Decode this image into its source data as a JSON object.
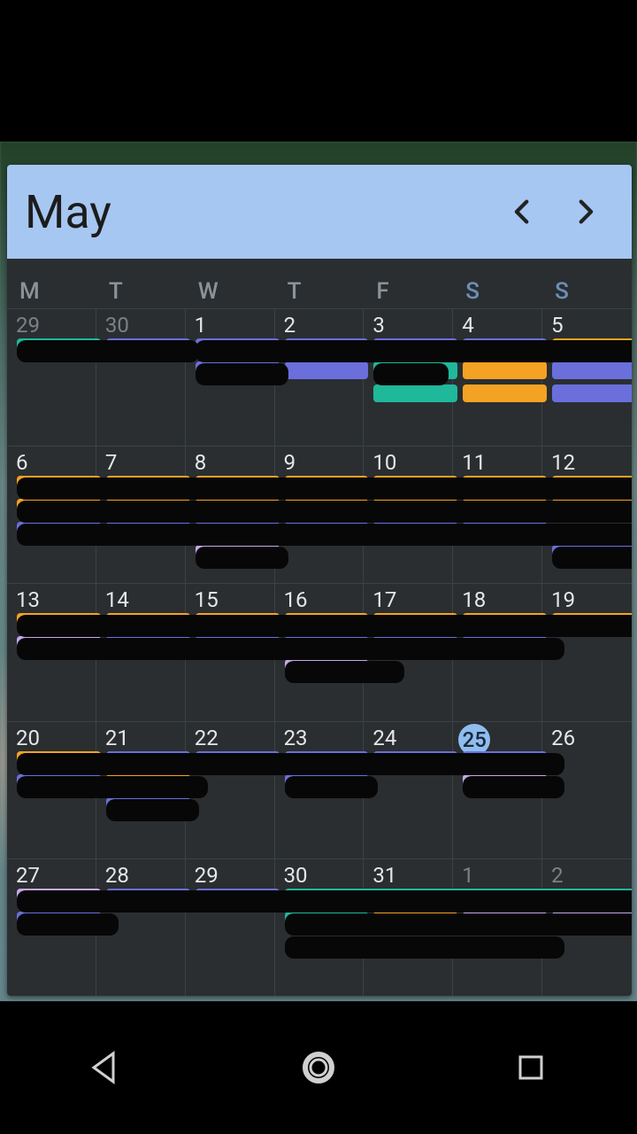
{
  "header": {
    "month_label": "May"
  },
  "dow": [
    "M",
    "T",
    "W",
    "T",
    "F",
    "S",
    "S"
  ],
  "weeks": [
    {
      "days": [
        {
          "n": 29,
          "dim": true
        },
        {
          "n": 30,
          "dim": true
        },
        {
          "n": 1
        },
        {
          "n": 2
        },
        {
          "n": 3
        },
        {
          "n": 4
        },
        {
          "n": 5
        }
      ]
    },
    {
      "days": [
        {
          "n": 6
        },
        {
          "n": 7
        },
        {
          "n": 8
        },
        {
          "n": 9
        },
        {
          "n": 10
        },
        {
          "n": 11
        },
        {
          "n": 12
        }
      ]
    },
    {
      "days": [
        {
          "n": 13
        },
        {
          "n": 14
        },
        {
          "n": 15
        },
        {
          "n": 16
        },
        {
          "n": 17
        },
        {
          "n": 18
        },
        {
          "n": 19
        }
      ]
    },
    {
      "days": [
        {
          "n": 20
        },
        {
          "n": 21
        },
        {
          "n": 22
        },
        {
          "n": 23
        },
        {
          "n": 24
        },
        {
          "n": 25,
          "today": true
        },
        {
          "n": 26
        }
      ]
    },
    {
      "days": [
        {
          "n": 27
        },
        {
          "n": 28
        },
        {
          "n": 29
        },
        {
          "n": 30
        },
        {
          "n": 31
        },
        {
          "n": 1,
          "dim": true
        },
        {
          "n": 2,
          "dim": true
        }
      ]
    }
  ],
  "colors": {
    "teal": "#1fb89a",
    "purple": "#6b6fdc",
    "orange": "#f4a223",
    "lilac": "#c7a8e8",
    "redact": "#070707"
  },
  "event_bars_note": "Event labels and details are redacted in the source image; bars below reconstruct visible geometry and color only.",
  "event_bars": [
    {
      "week": 0,
      "row": 0,
      "colStart": 0,
      "colSpan": 1,
      "color": "teal"
    },
    {
      "week": 0,
      "row": 0,
      "colStart": 1,
      "colSpan": 1,
      "color": "purple"
    },
    {
      "week": 0,
      "row": 0,
      "colStart": 2,
      "colSpan": 1,
      "color": "purple"
    },
    {
      "week": 0,
      "row": 0,
      "colStart": 3,
      "colSpan": 1,
      "color": "purple"
    },
    {
      "week": 0,
      "row": 0,
      "colStart": 4,
      "colSpan": 1,
      "color": "purple"
    },
    {
      "week": 0,
      "row": 0,
      "colStart": 5,
      "colSpan": 1,
      "color": "purple"
    },
    {
      "week": 0,
      "row": 0,
      "colStart": 6,
      "colSpan": 1,
      "color": "orange"
    },
    {
      "week": 0,
      "row": 1,
      "colStart": 2,
      "colSpan": 1,
      "color": "purple"
    },
    {
      "week": 0,
      "row": 1,
      "colStart": 3,
      "colSpan": 1,
      "color": "purple"
    },
    {
      "week": 0,
      "row": 1,
      "colStart": 4,
      "colSpan": 1,
      "color": "teal"
    },
    {
      "week": 0,
      "row": 1,
      "colStart": 5,
      "colSpan": 1,
      "color": "orange"
    },
    {
      "week": 0,
      "row": 1,
      "colStart": 6,
      "colSpan": 1,
      "color": "purple"
    },
    {
      "week": 0,
      "row": 2,
      "colStart": 4,
      "colSpan": 1,
      "color": "teal"
    },
    {
      "week": 0,
      "row": 2,
      "colStart": 5,
      "colSpan": 1,
      "color": "orange"
    },
    {
      "week": 0,
      "row": 2,
      "colStart": 6,
      "colSpan": 1,
      "color": "purple"
    },
    {
      "week": 0,
      "row": 0,
      "colStart": 0,
      "colSpan": 2.1,
      "color": "redact",
      "thick": true,
      "yoff": 2
    },
    {
      "week": 0,
      "row": 0,
      "colStart": 2,
      "colSpan": 5.2,
      "color": "redact",
      "thick": true,
      "yoff": 2
    },
    {
      "week": 0,
      "row": 1,
      "colStart": 2,
      "colSpan": 1.1,
      "color": "redact",
      "thick": true,
      "yoff": 2
    },
    {
      "week": 0,
      "row": 1,
      "colStart": 4,
      "colSpan": 0.9,
      "color": "redact",
      "thick": true,
      "yoff": 2
    },
    {
      "week": 1,
      "row": 0,
      "colStart": 0,
      "colSpan": 1,
      "color": "orange"
    },
    {
      "week": 1,
      "row": 0,
      "colStart": 1,
      "colSpan": 1,
      "color": "orange"
    },
    {
      "week": 1,
      "row": 0,
      "colStart": 2,
      "colSpan": 1,
      "color": "orange"
    },
    {
      "week": 1,
      "row": 0,
      "colStart": 3,
      "colSpan": 1,
      "color": "orange"
    },
    {
      "week": 1,
      "row": 0,
      "colStart": 4,
      "colSpan": 1,
      "color": "orange"
    },
    {
      "week": 1,
      "row": 0,
      "colStart": 5,
      "colSpan": 1,
      "color": "orange"
    },
    {
      "week": 1,
      "row": 0,
      "colStart": 6,
      "colSpan": 1,
      "color": "orange"
    },
    {
      "week": 1,
      "row": 1,
      "colStart": 0,
      "colSpan": 1,
      "color": "orange"
    },
    {
      "week": 1,
      "row": 1,
      "colStart": 1,
      "colSpan": 1,
      "color": "orange"
    },
    {
      "week": 1,
      "row": 1,
      "colStart": 2,
      "colSpan": 1,
      "color": "orange"
    },
    {
      "week": 1,
      "row": 1,
      "colStart": 3,
      "colSpan": 1,
      "color": "orange"
    },
    {
      "week": 1,
      "row": 1,
      "colStart": 4,
      "colSpan": 1,
      "color": "orange"
    },
    {
      "week": 1,
      "row": 1,
      "colStart": 5,
      "colSpan": 1,
      "color": "orange"
    },
    {
      "week": 1,
      "row": 1,
      "colStart": 6,
      "colSpan": 1,
      "color": "orange"
    },
    {
      "week": 1,
      "row": 2,
      "colStart": 0,
      "colSpan": 1,
      "color": "purple"
    },
    {
      "week": 1,
      "row": 2,
      "colStart": 1,
      "colSpan": 1,
      "color": "purple"
    },
    {
      "week": 1,
      "row": 2,
      "colStart": 2,
      "colSpan": 1,
      "color": "purple"
    },
    {
      "week": 1,
      "row": 2,
      "colStart": 3,
      "colSpan": 1,
      "color": "purple"
    },
    {
      "week": 1,
      "row": 2,
      "colStart": 4,
      "colSpan": 1,
      "color": "purple"
    },
    {
      "week": 1,
      "row": 2,
      "colStart": 5,
      "colSpan": 1,
      "color": "purple"
    },
    {
      "week": 1,
      "row": 3,
      "colStart": 2,
      "colSpan": 1,
      "color": "lilac"
    },
    {
      "week": 1,
      "row": 3,
      "colStart": 6,
      "colSpan": 1,
      "color": "purple"
    },
    {
      "week": 1,
      "row": 0,
      "colStart": 0,
      "colSpan": 7.2,
      "color": "redact",
      "thick": true,
      "yoff": 2
    },
    {
      "week": 1,
      "row": 1,
      "colStart": 0,
      "colSpan": 7.2,
      "color": "redact",
      "thick": true,
      "yoff": 2
    },
    {
      "week": 1,
      "row": 2,
      "colStart": 0,
      "colSpan": 7.2,
      "color": "redact",
      "thick": true,
      "yoff": 2
    },
    {
      "week": 1,
      "row": 3,
      "colStart": 2,
      "colSpan": 1.1,
      "color": "redact",
      "thick": true,
      "yoff": 2
    },
    {
      "week": 1,
      "row": 3,
      "colStart": 6,
      "colSpan": 1.3,
      "color": "redact",
      "thick": true,
      "yoff": 2
    },
    {
      "week": 2,
      "row": 0,
      "colStart": 0,
      "colSpan": 1,
      "color": "orange"
    },
    {
      "week": 2,
      "row": 0,
      "colStart": 1,
      "colSpan": 1,
      "color": "orange"
    },
    {
      "week": 2,
      "row": 0,
      "colStart": 2,
      "colSpan": 1,
      "color": "orange"
    },
    {
      "week": 2,
      "row": 0,
      "colStart": 3,
      "colSpan": 1,
      "color": "orange"
    },
    {
      "week": 2,
      "row": 0,
      "colStart": 4,
      "colSpan": 1,
      "color": "orange"
    },
    {
      "week": 2,
      "row": 0,
      "colStart": 5,
      "colSpan": 1,
      "color": "orange"
    },
    {
      "week": 2,
      "row": 0,
      "colStart": 6,
      "colSpan": 1,
      "color": "orange"
    },
    {
      "week": 2,
      "row": 1,
      "colStart": 0,
      "colSpan": 1,
      "color": "lilac"
    },
    {
      "week": 2,
      "row": 1,
      "colStart": 1,
      "colSpan": 1,
      "color": "purple"
    },
    {
      "week": 2,
      "row": 1,
      "colStart": 2,
      "colSpan": 1,
      "color": "purple"
    },
    {
      "week": 2,
      "row": 1,
      "colStart": 3,
      "colSpan": 1,
      "color": "purple"
    },
    {
      "week": 2,
      "row": 1,
      "colStart": 4,
      "colSpan": 1,
      "color": "purple"
    },
    {
      "week": 2,
      "row": 1,
      "colStart": 5,
      "colSpan": 1,
      "color": "purple"
    },
    {
      "week": 2,
      "row": 2,
      "colStart": 3,
      "colSpan": 1,
      "color": "lilac"
    },
    {
      "week": 2,
      "row": 0,
      "colStart": 0,
      "colSpan": 7.2,
      "color": "redact",
      "thick": true,
      "yoff": 2
    },
    {
      "week": 2,
      "row": 1,
      "colStart": 0,
      "colSpan": 6.2,
      "color": "redact",
      "thick": true,
      "yoff": 2
    },
    {
      "week": 2,
      "row": 2,
      "colStart": 3,
      "colSpan": 1.4,
      "color": "redact",
      "thick": true,
      "yoff": 2
    },
    {
      "week": 3,
      "row": 0,
      "colStart": 0,
      "colSpan": 1,
      "color": "orange"
    },
    {
      "week": 3,
      "row": 0,
      "colStart": 1,
      "colSpan": 1,
      "color": "purple"
    },
    {
      "week": 3,
      "row": 0,
      "colStart": 2,
      "colSpan": 1,
      "color": "purple"
    },
    {
      "week": 3,
      "row": 0,
      "colStart": 3,
      "colSpan": 1,
      "color": "purple"
    },
    {
      "week": 3,
      "row": 0,
      "colStart": 4,
      "colSpan": 1,
      "color": "purple"
    },
    {
      "week": 3,
      "row": 0,
      "colStart": 5,
      "colSpan": 1,
      "color": "purple"
    },
    {
      "week": 3,
      "row": 1,
      "colStart": 0,
      "colSpan": 1,
      "color": "purple"
    },
    {
      "week": 3,
      "row": 1,
      "colStart": 1,
      "colSpan": 1,
      "color": "orange"
    },
    {
      "week": 3,
      "row": 1,
      "colStart": 3,
      "colSpan": 1,
      "color": "purple"
    },
    {
      "week": 3,
      "row": 1,
      "colStart": 5,
      "colSpan": 1,
      "color": "lilac"
    },
    {
      "week": 3,
      "row": 2,
      "colStart": 1,
      "colSpan": 1,
      "color": "purple"
    },
    {
      "week": 3,
      "row": 0,
      "colStart": 0,
      "colSpan": 6.2,
      "color": "redact",
      "thick": true,
      "yoff": 2
    },
    {
      "week": 3,
      "row": 1,
      "colStart": 0,
      "colSpan": 2.2,
      "color": "redact",
      "thick": true,
      "yoff": 2
    },
    {
      "week": 3,
      "row": 1,
      "colStart": 3,
      "colSpan": 1.1,
      "color": "redact",
      "thick": true,
      "yoff": 2
    },
    {
      "week": 3,
      "row": 1,
      "colStart": 5,
      "colSpan": 1.2,
      "color": "redact",
      "thick": true,
      "yoff": 2
    },
    {
      "week": 3,
      "row": 2,
      "colStart": 1,
      "colSpan": 1.1,
      "color": "redact",
      "thick": true,
      "yoff": 2
    },
    {
      "week": 4,
      "row": 0,
      "colStart": 0,
      "colSpan": 1,
      "color": "lilac"
    },
    {
      "week": 4,
      "row": 0,
      "colStart": 1,
      "colSpan": 1,
      "color": "purple"
    },
    {
      "week": 4,
      "row": 0,
      "colStart": 2,
      "colSpan": 1,
      "color": "purple"
    },
    {
      "week": 4,
      "row": 0,
      "colStart": 3,
      "colSpan": 4,
      "color": "teal"
    },
    {
      "week": 4,
      "row": 1,
      "colStart": 0,
      "colSpan": 1,
      "color": "purple"
    },
    {
      "week": 4,
      "row": 1,
      "colStart": 3,
      "colSpan": 1,
      "color": "teal"
    },
    {
      "week": 4,
      "row": 1,
      "colStart": 4,
      "colSpan": 1,
      "color": "orange"
    },
    {
      "week": 4,
      "row": 1,
      "colStart": 5,
      "colSpan": 1,
      "color": "lilac"
    },
    {
      "week": 4,
      "row": 1,
      "colStart": 6,
      "colSpan": 1,
      "color": "lilac"
    },
    {
      "week": 4,
      "row": 0,
      "colStart": 0,
      "colSpan": 7.2,
      "color": "redact",
      "thick": true,
      "yoff": 2
    },
    {
      "week": 4,
      "row": 1,
      "colStart": 0,
      "colSpan": 1.2,
      "color": "redact",
      "thick": true,
      "yoff": 2
    },
    {
      "week": 4,
      "row": 1,
      "colStart": 3,
      "colSpan": 4.2,
      "color": "redact",
      "thick": true,
      "yoff": 2
    },
    {
      "week": 4,
      "row": 2,
      "colStart": 3,
      "colSpan": 3.2,
      "color": "redact",
      "thick": true,
      "yoff": 2
    }
  ]
}
